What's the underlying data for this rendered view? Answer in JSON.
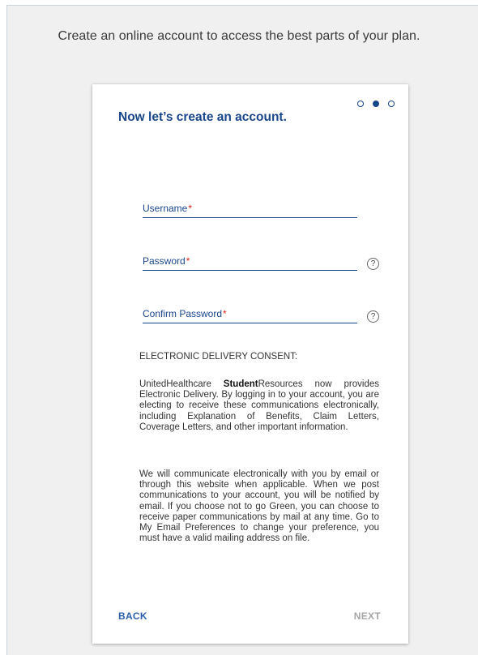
{
  "page": {
    "intro_text": "Create an online account to access the best parts of your plan."
  },
  "card": {
    "title": "Now let’s create an account.",
    "steps": [
      {
        "state": "incomplete"
      },
      {
        "state": "active"
      },
      {
        "state": "incomplete"
      }
    ]
  },
  "form": {
    "username": {
      "label": "Username",
      "required_mark": "*"
    },
    "password": {
      "label": "Password",
      "required_mark": "*",
      "help_icon": "question-circle",
      "help_glyph": "?"
    },
    "confirm_password": {
      "label": "Confirm Password",
      "required_mark": "*",
      "help_icon": "question-circle",
      "help_glyph": "?"
    }
  },
  "consent": {
    "heading": "ELECTRONIC DELIVERY CONSENT:",
    "para1_prefix": "UnitedHealthcare ",
    "para1_brand_bold": "Student",
    "para1_text": "Resources now provides Electronic Delivery. By logging in to your account, you are electing to receive these communications electronically, including Explanation of Benefits, Claim Letters, Coverage Letters, and other important information.",
    "para2": "We will communicate electronically with you by email or through this website when applicable. When we post communications to your account, you will be notified by email. If you choose not to go Green, you can choose to receive paper communications by mail at any time. Go to My Email Preferences to change your preference, you must have a valid mailing address on file."
  },
  "nav": {
    "back_label": "BACK",
    "next_label": "NEXT"
  },
  "colors": {
    "accent": "#19468a",
    "link": "#2b5ea8",
    "required": "#d9251c",
    "disabled": "#a5a5a5",
    "page_bg": "#f0f0f0"
  }
}
